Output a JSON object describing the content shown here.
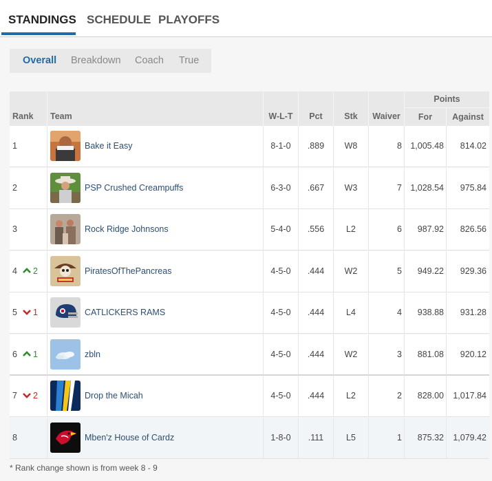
{
  "nav": {
    "tabs": [
      {
        "label": "STANDINGS",
        "active": true
      },
      {
        "label": "SCHEDULE",
        "active": false
      },
      {
        "label": "PLAYOFFS",
        "active": false
      }
    ]
  },
  "subtabs": [
    {
      "label": "Overall",
      "active": true
    },
    {
      "label": "Breakdown",
      "active": false
    },
    {
      "label": "Coach",
      "active": false
    },
    {
      "label": "True",
      "active": false
    }
  ],
  "table": {
    "group_header": "Points",
    "headers": {
      "rank": "Rank",
      "team": "Team",
      "wlt": "W-L-T",
      "pct": "Pct",
      "stk": "Stk",
      "waiver": "Waiver",
      "for": "For",
      "against": "Against"
    },
    "rows": [
      {
        "rank": "1",
        "change": "",
        "dir": "",
        "team": "Bake it Easy",
        "wlt": "8-1-0",
        "pct": ".889",
        "stk": "W8",
        "waiver": "8",
        "for": "1,005.48",
        "against": "814.02",
        "avatar": "photo-man-icon"
      },
      {
        "rank": "2",
        "change": "",
        "dir": "",
        "team": "PSP Crushed Creampuffs",
        "wlt": "6-3-0",
        "pct": ".667",
        "stk": "W3",
        "waiver": "7",
        "for": "1,028.54",
        "against": "975.84",
        "avatar": "photo-cowboy-icon"
      },
      {
        "rank": "3",
        "change": "",
        "dir": "",
        "team": "Rock Ridge Johnsons",
        "wlt": "5-4-0",
        "pct": ".556",
        "stk": "L2",
        "waiver": "6",
        "for": "987.92",
        "against": "826.56",
        "avatar": "photo-group-icon"
      },
      {
        "rank": "4",
        "change": "2",
        "dir": "up",
        "team": "PiratesOfThePancreas",
        "wlt": "4-5-0",
        "pct": ".444",
        "stk": "W2",
        "waiver": "5",
        "for": "949.22",
        "against": "929.36",
        "avatar": "pirate-icon"
      },
      {
        "rank": "5",
        "change": "1",
        "dir": "down",
        "team": "CATLICKERS RAMS",
        "wlt": "4-5-0",
        "pct": ".444",
        "stk": "L4",
        "waiver": "4",
        "for": "938.88",
        "against": "931.28",
        "avatar": "helmet-icon"
      },
      {
        "rank": "6",
        "change": "1",
        "dir": "up",
        "team": "zbln",
        "wlt": "4-5-0",
        "pct": ".444",
        "stk": "W2",
        "waiver": "3",
        "for": "881.08",
        "against": "920.12",
        "avatar": "sky-icon"
      },
      {
        "rank": "7",
        "change": "2",
        "dir": "down",
        "team": "Drop the Micah",
        "wlt": "4-5-0",
        "pct": ".444",
        "stk": "L2",
        "waiver": "2",
        "for": "828.00",
        "against": "1,017.84",
        "avatar": "bolt-icon"
      },
      {
        "rank": "8",
        "change": "",
        "dir": "",
        "team": "Mben'z House of Cardz",
        "wlt": "1-8-0",
        "pct": ".111",
        "stk": "L5",
        "waiver": "1",
        "for": "875.32",
        "against": "1,079.42",
        "avatar": "cardinal-icon"
      }
    ]
  },
  "footnote": "* Rank change shown is from week 8 - 9",
  "colors": {
    "accent": "#1f6aa8",
    "up": "#2e8b2e",
    "down": "#c62828"
  }
}
